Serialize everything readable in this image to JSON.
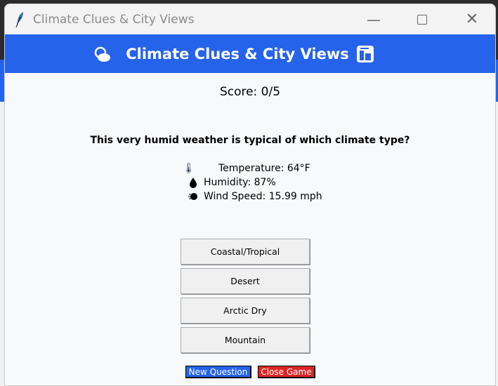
{
  "window": {
    "title": "Climate Clues & City Views",
    "app_icon": "feather-icon"
  },
  "header": {
    "title": "Climate Clues & City Views",
    "left_icon": "sun-cloud-icon",
    "right_icon": "cityscape-icon",
    "color": "#2563eb"
  },
  "score": "Score: 0/5",
  "question": "This very humid weather is typical of which climate type?",
  "weather": [
    {
      "icon": "thermometer-icon",
      "text": "Temperature: 64°F"
    },
    {
      "icon": "droplet-icon",
      "text": "Humidity: 87%"
    },
    {
      "icon": "wind-icon",
      "text": "Wind Speed: 15.99 mph"
    }
  ],
  "answers": [
    "Coastal/Tropical",
    "Desert",
    "Arctic Dry",
    "Mountain"
  ],
  "buttons": {
    "new_question": "New Question",
    "close_game": "Close Game",
    "new_color": "#2563eb",
    "close_color": "#dc2626"
  }
}
